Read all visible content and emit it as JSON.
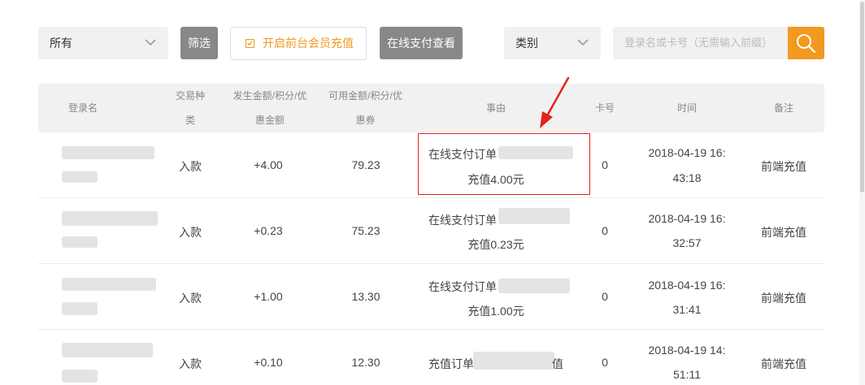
{
  "toolbar": {
    "scope_select": "所有",
    "filter_button": "筛选",
    "member_recharge_checkbox": "开启前台会员充值",
    "online_pay_button": "在线支付查看",
    "category_select": "类别",
    "search_placeholder": "登录名或卡号（无需输入前缀）"
  },
  "table": {
    "headers": {
      "login": "登录名",
      "type_line1": "交易种",
      "type_line2": "类",
      "amount_line1": "发生金额/积分/优",
      "amount_line2": "惠金额",
      "available_line1": "可用金额/积分/优",
      "available_line2": "惠券",
      "reason": "事由",
      "card": "卡号",
      "time": "时间",
      "note": "备注"
    },
    "rows": [
      {
        "type": "入款",
        "amount": "+4.00",
        "available": "79.23",
        "reason_line1": "在线支付订单",
        "reason_line2": "充值4.00元",
        "card": "0",
        "time_line1": "2018-04-19 16:",
        "time_line2": "43:18",
        "note": "前端充值"
      },
      {
        "type": "入款",
        "amount": "+0.23",
        "available": "75.23",
        "reason_line1": "在线支付订单",
        "reason_line2": "充值0.23元",
        "card": "0",
        "time_line1": "2018-04-19 16:",
        "time_line2": "32:57",
        "note": "前端充值"
      },
      {
        "type": "入款",
        "amount": "+1.00",
        "available": "13.30",
        "reason_line1": "在线支付订单",
        "reason_line2": "充值1.00元",
        "card": "0",
        "time_line1": "2018-04-19 16:",
        "time_line2": "31:41",
        "note": "前端充值"
      },
      {
        "type": "入款",
        "amount": "+0.10",
        "available": "12.30",
        "reason_line1": "充值订单",
        "reason_tail": "值",
        "card": "0",
        "time_line1": "2018-04-19 14:",
        "time_line2": "51:11",
        "note": "前端充值"
      }
    ]
  },
  "colors": {
    "accent": "#f19a1f",
    "highlight": "#e2231a"
  }
}
